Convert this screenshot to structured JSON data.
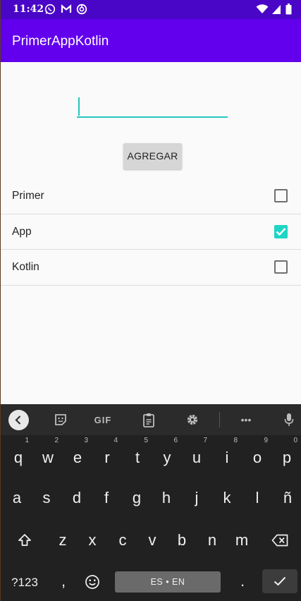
{
  "status_bar": {
    "time": "11:42",
    "left_icons": [
      "whatsapp-icon",
      "gmail-icon",
      "vpn-icon"
    ],
    "right_icons": [
      "wifi-icon",
      "signal-icon",
      "battery-icon"
    ]
  },
  "app_bar": {
    "title": "PrimerAppKotlin"
  },
  "input": {
    "value": "",
    "placeholder": ""
  },
  "add_button": {
    "label": "AGREGAR"
  },
  "items": [
    {
      "label": "Primer",
      "checked": false
    },
    {
      "label": "App",
      "checked": true
    },
    {
      "label": "Kotlin",
      "checked": false
    }
  ],
  "accent_color": "#1ed5c4",
  "brand_color": "#6200ee",
  "keyboard": {
    "toolbar": {
      "gif_label": "GIF",
      "more_label": "•••"
    },
    "row1": [
      {
        "k": "q",
        "s": "1"
      },
      {
        "k": "w",
        "s": "2"
      },
      {
        "k": "e",
        "s": "3"
      },
      {
        "k": "r",
        "s": "4"
      },
      {
        "k": "t",
        "s": "5"
      },
      {
        "k": "y",
        "s": "6"
      },
      {
        "k": "u",
        "s": "7"
      },
      {
        "k": "i",
        "s": "8"
      },
      {
        "k": "o",
        "s": "9"
      },
      {
        "k": "p",
        "s": "0"
      }
    ],
    "row2": [
      "a",
      "s",
      "d",
      "f",
      "g",
      "h",
      "j",
      "k",
      "l",
      "ñ"
    ],
    "row3": [
      "z",
      "x",
      "c",
      "v",
      "b",
      "n",
      "m"
    ],
    "symbols_label": "?123",
    "comma_label": ",",
    "period_label": ".",
    "space_label": "ES • EN"
  }
}
